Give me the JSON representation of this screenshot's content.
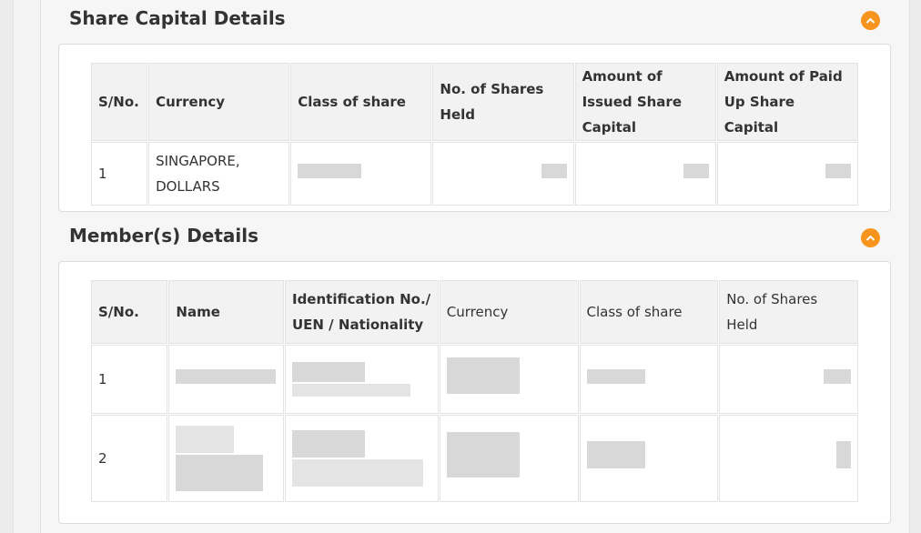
{
  "share_capital": {
    "title": "Share Capital Details",
    "headers": [
      "S/No.",
      "Currency",
      "Class of share",
      "No. of Shares Held",
      "Amount of Issued Share Capital",
      "Amount of Paid Up Share Capital"
    ],
    "rows": [
      {
        "sno": "1",
        "currency": "SINGAPORE, DOLLARS"
      }
    ]
  },
  "members": {
    "title": "Member(s) Details",
    "headers": [
      "S/No.",
      "Name",
      "Identification No./ UEN / Nationality",
      "Currency",
      "Class of share",
      "No. of Shares Held"
    ],
    "rows": [
      {
        "sno": "1"
      },
      {
        "sno": "2"
      }
    ]
  },
  "colors": {
    "accent": "#f7941d",
    "header_bg": "#f2f2f2",
    "border": "#dcdcdc"
  }
}
